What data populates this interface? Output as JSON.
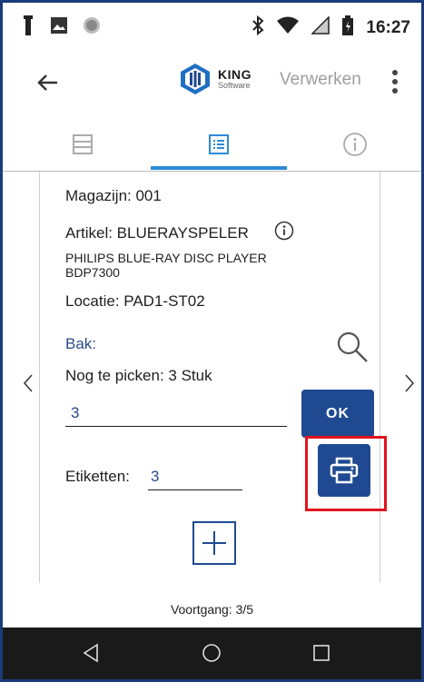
{
  "status_bar": {
    "time": "16:27",
    "icons_left": [
      "notification-figure-icon",
      "image-icon",
      "circle-dot-icon"
    ],
    "icons_right": [
      "bluetooth-icon",
      "wifi-icon",
      "signal-icon",
      "battery-icon"
    ]
  },
  "app_bar": {
    "back_icon": "arrow-left-icon",
    "logo_name": "KING",
    "logo_sub": "Software",
    "action_label": "Verwerken",
    "menu_icon": "more-vert-icon"
  },
  "tabs": {
    "items": [
      "list-icon",
      "details-list-icon",
      "info-icon"
    ],
    "active_index": 1
  },
  "details": {
    "magazijn": "Magazijn: 001",
    "artikel": "Artikel: BLUERAYSPELER",
    "description_line1": "PHILIPS BLUE-RAY DISC PLAYER",
    "description_line2": "BDP7300",
    "locatie": "Locatie: PAD1-ST02",
    "bak_label": "Bak:",
    "nog_te_picken": "Nog te picken: 3 Stuk",
    "quantity_value": "3",
    "ok_label": "OK",
    "etiketten_label": "Etiketten:",
    "etiketten_value": "3"
  },
  "progress": {
    "text": "Voortgang: 3/5"
  },
  "colors": {
    "primary": "#1f4a91",
    "accent": "#2a8bd8",
    "highlight": "#e0141e",
    "frame": "#1a3c7a"
  }
}
